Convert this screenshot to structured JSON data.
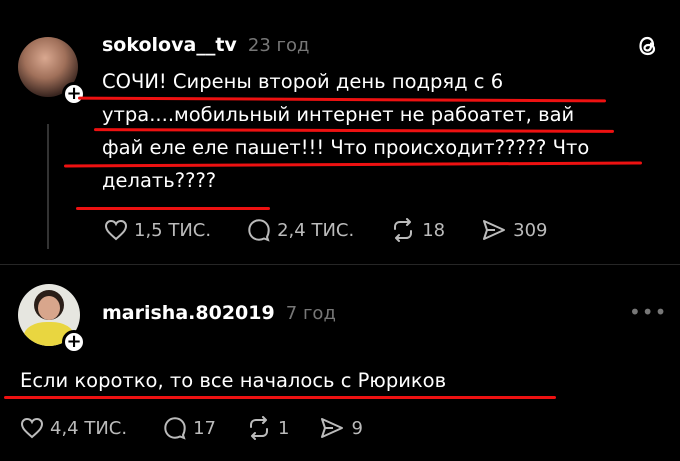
{
  "posts": [
    {
      "username": "sokolova__tv",
      "time": "23 год",
      "lines": [
        "СОЧИ! Сирены второй день подряд с 6",
        "утра....мобильный интернет не рабоатет, вай",
        "фай еле еле пашет!!! Что происходит????? Что",
        "делать????"
      ],
      "likes": "1,5 ТИС.",
      "replies": "2,4 ТИС.",
      "reposts": "18",
      "shares": "309"
    },
    {
      "username": "marisha.802019",
      "time": "7 год",
      "text": "Если коротко, то все началось с Рюриков",
      "likes": "4,4 ТИС.",
      "replies": "17",
      "reposts": "1",
      "shares": "9"
    }
  ],
  "colors": {
    "annotation": "#e11111",
    "background": "#000000"
  }
}
